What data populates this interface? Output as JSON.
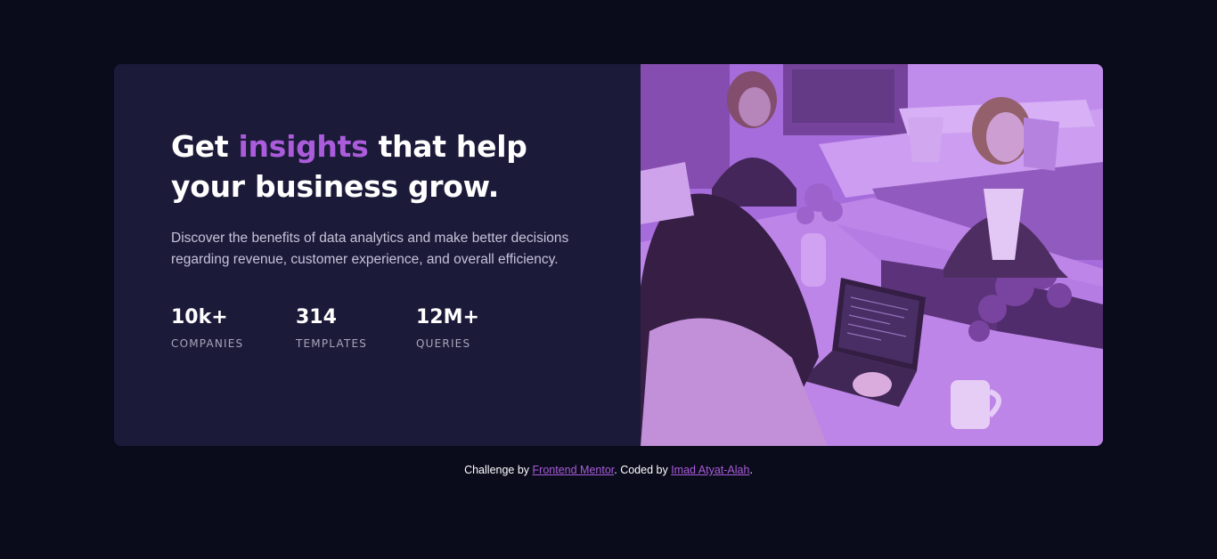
{
  "card": {
    "headline": {
      "part1": "Get ",
      "accent": "insights",
      "part2": " that help your business grow."
    },
    "description": "Discover the benefits of data analytics and make better decisions regarding revenue, customer experience, and overall efficiency.",
    "stats": [
      {
        "value": "10k+",
        "label": "Companies"
      },
      {
        "value": "314",
        "label": "Templates"
      },
      {
        "value": "12M+",
        "label": "Queries"
      }
    ],
    "image_alt": "Team of people working at a shared desk with laptops"
  },
  "footer": {
    "prefix": "Challenge by ",
    "link1": "Frontend Mentor",
    "middle": ". Coded by ",
    "link2": "Imad Atyat-Alah",
    "suffix": "."
  },
  "colors": {
    "page_bg": "#0a0c1b",
    "card_bg": "#1c1a39",
    "accent": "#aa5cdb",
    "image_tint": "#a974e0"
  }
}
